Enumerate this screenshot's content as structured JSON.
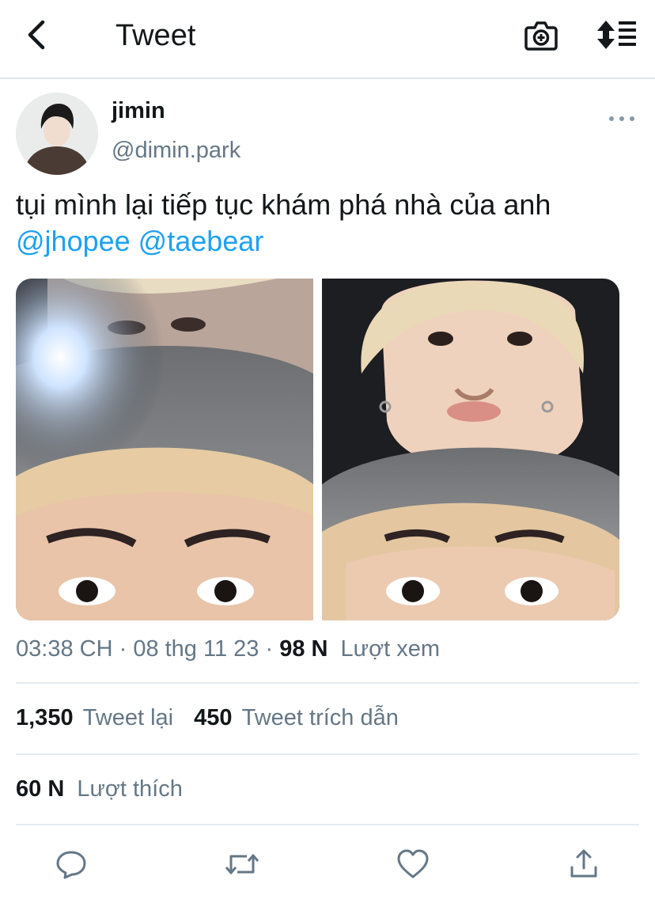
{
  "header": {
    "title": "Tweet",
    "icons": {
      "back": "chevron-left-icon",
      "camera": "camera-plus-icon",
      "sort": "sort-icon"
    }
  },
  "tweet": {
    "display_name": "jimin",
    "handle": "@dimin.park",
    "text": "tụi mình lại tiếp tục khám phá nhà của anh",
    "mentions": [
      "@jhopee",
      "@taebear"
    ],
    "time": "03:38 CH",
    "separator": "·",
    "date": "08 thg 11 23",
    "views_count": "98 N",
    "views_label": "Lượt xem"
  },
  "stats": {
    "retweets_count": "1,350",
    "retweets_label": "Tweet lại",
    "quotes_count": "450",
    "quotes_label": "Tweet trích dẫn",
    "likes_count": "60 N",
    "likes_label": "Lượt thích"
  },
  "colors": {
    "link": "#1da1f2",
    "secondary_text": "#657786",
    "primary_text": "#14171a",
    "divider": "#e6ecf0"
  }
}
